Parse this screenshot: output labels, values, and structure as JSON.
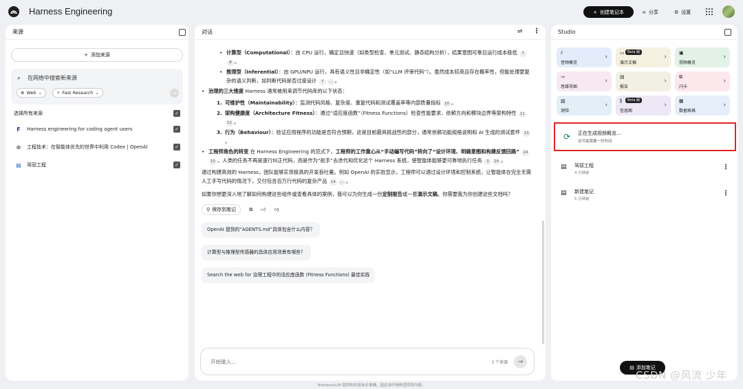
{
  "app": {
    "title": "Harness Engineering"
  },
  "topbar": {
    "create_notebook": "创建笔记本",
    "share": "分享",
    "settings": "设置"
  },
  "left": {
    "title": "来源",
    "add_source": "添加来源",
    "search_placeholder": "在网络中搜索新来源",
    "chip_web": "Web",
    "chip_research": "Fast Research",
    "select_all": "选择所有来源",
    "sources": [
      {
        "icon": "F",
        "label": "Harness engineering for coding agent users"
      },
      {
        "icon": "⊛",
        "label": "工程技术：在智能体优先的世界中利用 Codex | OpenAI"
      },
      {
        "icon": "▤",
        "label": "驾驭工程"
      }
    ]
  },
  "mid": {
    "title": "对话",
    "b_comp_title": "计算型（Computational）",
    "b_comp_text": "：由 CPU 运行，确定且快速（如类型检查、单元测试、静态结构分析），结果意图可靠且运行成本极低",
    "b_comp_cites": [
      "7",
      "8"
    ],
    "b_inf_title": "推理型（Inferential）",
    "b_inf_text": "：由 GPU/NPU 运行，具有语义性且非确定性（如“LLM 评审代码”）。虽然成本较高且存在概率性，但能处理更复杂的语义判断，如判断代码是否过度设计",
    "b_inf_cites": [
      "7",
      "…"
    ],
    "b3_title": "治理的三大维度",
    "b3_text": " Harness 通常被用来调节代码库的以下状态：",
    "n1_title": "可维护性（Maintainability）",
    "n1_text": "：监测代码风格、复杂度、重复代码和测试覆盖率等内部质量指标",
    "n1_cites": [
      "10"
    ],
    "n2_title": "架构健康度（Architecture Fitness）",
    "n2_text": "：通过“适应度函数”（Fitness Functions）检查性能要求、依赖方向和模块边界等架构特性",
    "n2_cites": [
      "11",
      "12"
    ],
    "n3_title": "行为（Behaviour）",
    "n3_text": "：验证应用程序的功能是否符合预期，这是目前最具挑战性的部分，通常依赖功能规格说明和 AI 生成的测试套件",
    "n3_cites": [
      "13"
    ],
    "b4_title": "工程师角色的转变",
    "b4_pre": " 在 Harness Engineering 的范式下，",
    "b4_bold": "工程师的工作重心从“手动编写代码”转向了“设计环境、明确意图和构建反馈回路”",
    "b4_cites1": [
      "14",
      "15"
    ],
    "b4_post": "。人类的任务不再是逐行纠正代码，而是作为“舵手”去迭代和优化这个 Harness 系统，使智能体能够更可靠地执行任务",
    "b4_cites2": [
      "3",
      "14"
    ],
    "p1": "通过构建高效的 Harness，团队能够实现极高的开发吞吐量。例如 OpenAI 的实验显示，工程师可以通过设计环境和控制系统，让智能体在完全无需人工手写代码的情况下，交付包含百万行代码的复杂产品",
    "p1_cites": [
      "14",
      "…"
    ],
    "p2_pre": "如果你想更深入地了解如何构建这些组件或查看具体的案例，我可以为你生成一份",
    "p2_b1": "定制报告",
    "p2_mid": "或一套",
    "p2_b2": "演示文稿",
    "p2_post": "。你需要我为你创建这些文档吗？",
    "save_note": "保存到笔记",
    "suggestions": [
      "OpenAI 提到的“AGENTS.md”具体包含什么内容？",
      "计算型与推理型传感器的具体应用场景有哪些？",
      "Search the web for 治理工程中的适应度函数 (Fitness Functions) 最佳实践"
    ],
    "input_placeholder": "开始输入...",
    "source_count": "3 个来源"
  },
  "right": {
    "title": "Studio",
    "beta": "Beta 版",
    "tiles": [
      {
        "icon": "⫽",
        "label": "音频概览",
        "bg": "#e4ecfb",
        "beta": false
      },
      {
        "icon": "▭",
        "label": "演示文稿",
        "bg": "#f4f1e0",
        "beta": true
      },
      {
        "icon": "▣",
        "label": "视频概览",
        "bg": "#e3f2e6",
        "beta": false
      },
      {
        "icon": "⊸",
        "label": "思维导图",
        "bg": "#f6e9f0",
        "beta": false
      },
      {
        "icon": "▤",
        "label": "报告",
        "bg": "#f2efe3",
        "beta": false
      },
      {
        "icon": "⧉",
        "label": "闪卡",
        "bg": "#fbe7ec",
        "beta": false
      },
      {
        "icon": "▨",
        "label": "测验",
        "bg": "#e3eff7",
        "beta": false
      },
      {
        "icon": "⫼",
        "label": "信息图",
        "bg": "#ece8f6",
        "beta": true
      },
      {
        "icon": "▦",
        "label": "数据表格",
        "bg": "#e5eef9",
        "beta": false
      }
    ],
    "generating_title": "正在生成视频概览...",
    "generating_sub": "这可能需要一些时间",
    "notes": [
      {
        "title": "驾驭工程",
        "time": "4 分钟前"
      },
      {
        "title": "新建笔记",
        "time": "5 分钟前"
      }
    ],
    "add_note": "添加笔记"
  },
  "footer": "NotebookLM 提供的内容未必准确，因此请仔细核查回答内容。",
  "watermark": "CSDN @风流 少年"
}
